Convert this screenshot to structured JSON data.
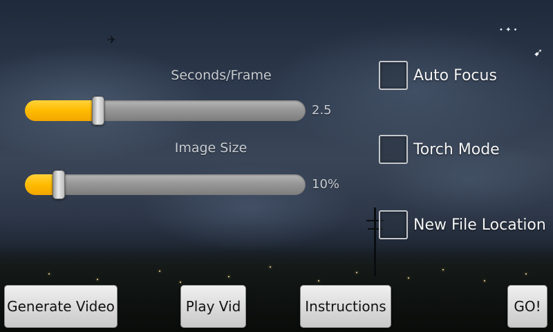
{
  "sliders": {
    "seconds_frame": {
      "label": "Seconds/Frame",
      "value_text": "2.5",
      "level": 0.26
    },
    "image_size": {
      "label": "Image Size",
      "value_text": "10%",
      "level": 0.12
    }
  },
  "checkboxes": [
    {
      "label": "Auto Focus",
      "checked": false
    },
    {
      "label": "Torch Mode",
      "checked": false
    },
    {
      "label": "New File Location",
      "checked": false
    }
  ],
  "buttons": {
    "generate": "Generate Video",
    "play": "Play Vid",
    "instructions": "Instructions",
    "go": "GO!"
  },
  "colors": {
    "slider_fill": "#ffbb00",
    "slider_track": "#9a9a9a",
    "button_bg": "#dcdcdc"
  },
  "icons": [
    "airplane-icon",
    "arrow-cursor-icon"
  ]
}
